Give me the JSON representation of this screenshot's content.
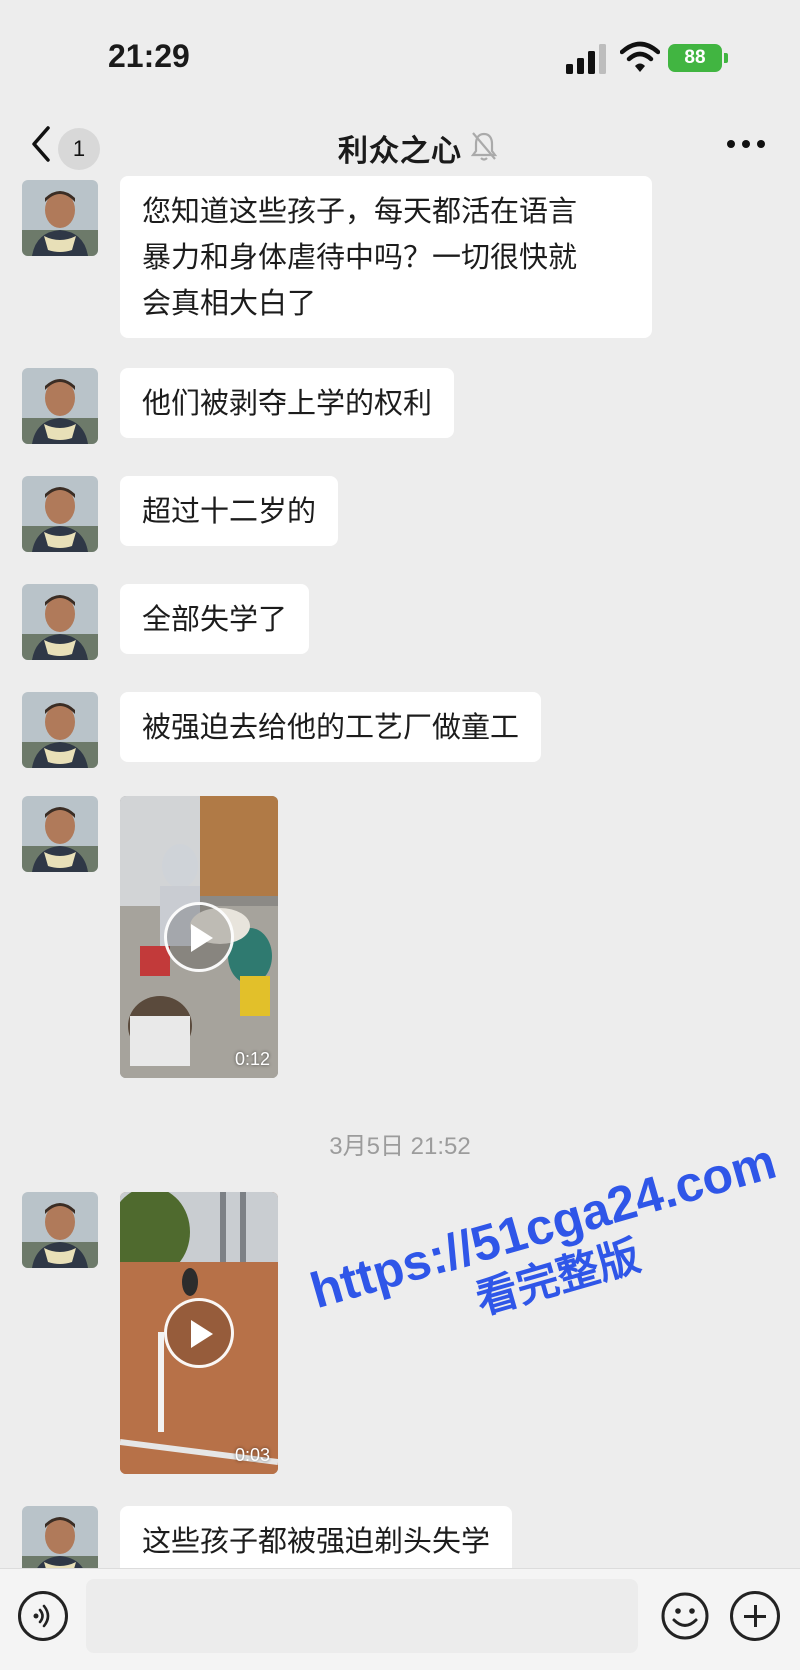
{
  "status_bar": {
    "time": "21:29",
    "battery": "88"
  },
  "header": {
    "unread_count": "1",
    "title": "利众之心"
  },
  "messages": [
    {
      "type": "text",
      "lines": [
        "您知道这些孩子，每天都活在语言",
        "暴力和身体虐待中吗？一切很快就",
        "会真相大白了"
      ]
    },
    {
      "type": "text",
      "text": "他们被剥夺上学的权利"
    },
    {
      "type": "text",
      "text": "超过十二岁的"
    },
    {
      "type": "text",
      "text": "全部失学了"
    },
    {
      "type": "text",
      "text": "被强迫去给他的工艺厂做童工"
    },
    {
      "type": "video",
      "duration": "0:12"
    },
    {
      "type": "video",
      "duration": "0:03"
    },
    {
      "type": "text",
      "text": "这些孩子都被强迫剃头失学"
    }
  ],
  "timestamp": "3月5日 21:52",
  "watermark": {
    "line1": "https://51cga24.com",
    "line2": "看完整版"
  },
  "icons": [
    "back-icon",
    "mute-icon",
    "more-icon",
    "voice-icon",
    "emoji-icon",
    "plus-icon",
    "play-icon",
    "signal-icon",
    "wifi-icon"
  ],
  "colors": {
    "background": "#ededed",
    "bubble": "#ffffff",
    "battery": "#41b541",
    "watermark": "#2f56e8"
  }
}
